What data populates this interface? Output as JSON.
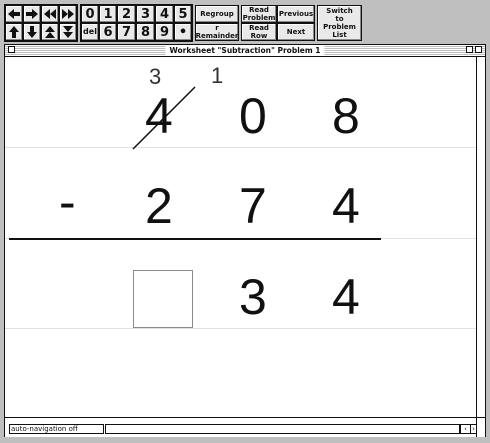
{
  "toolbar": {
    "digits_top": [
      "0",
      "1",
      "2",
      "3",
      "4",
      "5"
    ],
    "del_label": "del",
    "digits_bottom": [
      "6",
      "7",
      "8",
      "9",
      "•"
    ],
    "regroup_label": "Regroup",
    "remainder_label": "r Remainder",
    "read_problem_label": "Read Problem",
    "read_row_label": "Read Row",
    "previous_label": "Previous",
    "next_label": "Next",
    "switch_label": "Switch to Problem List"
  },
  "window": {
    "title": "Worksheet \"Subtraction\" Problem 1"
  },
  "problem": {
    "operator": "-",
    "top_digits": [
      "4",
      "0",
      "8"
    ],
    "bottom_digits": [
      "2",
      "7",
      "4"
    ],
    "carry_hundreds": "3",
    "carry_tens": "1",
    "crossed_digit": "4",
    "answer_digits": [
      "3",
      "4"
    ],
    "answer_hundreds_empty": ""
  },
  "status": {
    "navigation": "auto-navigation off"
  }
}
